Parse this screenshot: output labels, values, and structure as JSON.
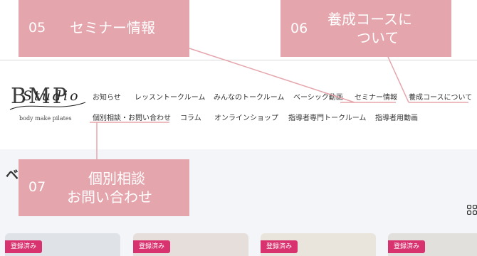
{
  "logo": {
    "main": "BMP",
    "script": "Studio",
    "sub": "body make pilates"
  },
  "nav": {
    "row1": [
      "お知らせ",
      "レッスントークルーム",
      "みんなのトークルーム",
      "ベーシック動画",
      "セミナー情報",
      "養成コースについて"
    ],
    "row2": [
      "個別相談・お問い合わせ",
      "コラム",
      "オンラインショップ",
      "指導者専門トークルーム",
      "指導者用動画"
    ]
  },
  "callouts": {
    "c05": {
      "num": "05",
      "text": "セミナー情報"
    },
    "c06": {
      "num": "06",
      "line1": "養成コースに",
      "line2": "ついて"
    },
    "c07": {
      "num": "07",
      "line1": "個別相談",
      "line2": "お問い合わせ"
    }
  },
  "section": {
    "heading_glyph": "ベ"
  },
  "cards": [
    {
      "badge": "登録済み"
    },
    {
      "badge": "登録済み"
    },
    {
      "badge": "登録済み"
    },
    {
      "badge": "登録済み"
    }
  ],
  "colors": {
    "callout": "#e5a5ac",
    "badge": "#d9336f",
    "page_bg": "#f4f5f8"
  },
  "icons": {
    "view_toggle": "grid-icon"
  }
}
